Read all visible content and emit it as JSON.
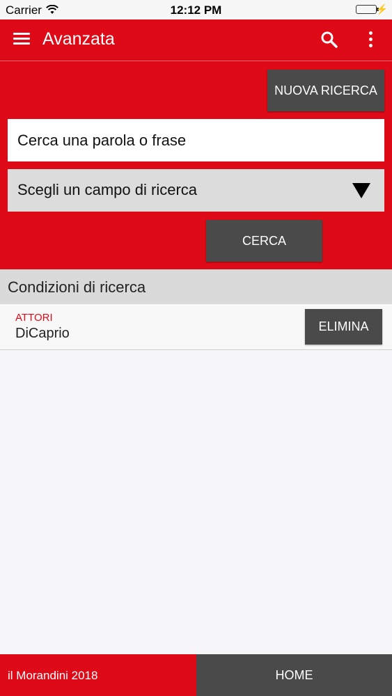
{
  "status_bar": {
    "carrier": "Carrier",
    "time": "12:12 PM",
    "battery_color": "#4cd964"
  },
  "app_bar": {
    "title": "Avanzata",
    "icons": [
      "menu-icon",
      "search-icon",
      "more-vert-icon"
    ],
    "background": "#de0a17"
  },
  "search": {
    "new_search_label": "NUOVA RICERCA",
    "query_placeholder": "Cerca una parola o frase",
    "field_select_label": "Scegli un campo di ricerca",
    "search_button_label": "CERCA"
  },
  "conditions": {
    "header": "Condizioni di ricerca",
    "items": [
      {
        "field": "ATTORI",
        "value": "DiCaprio",
        "delete_label": "ELIMINA"
      }
    ]
  },
  "footer": {
    "brand": "il Morandini 2018",
    "home_label": "HOME"
  },
  "colors": {
    "accent": "#de0a17",
    "button_dark": "#4a4a4a"
  }
}
